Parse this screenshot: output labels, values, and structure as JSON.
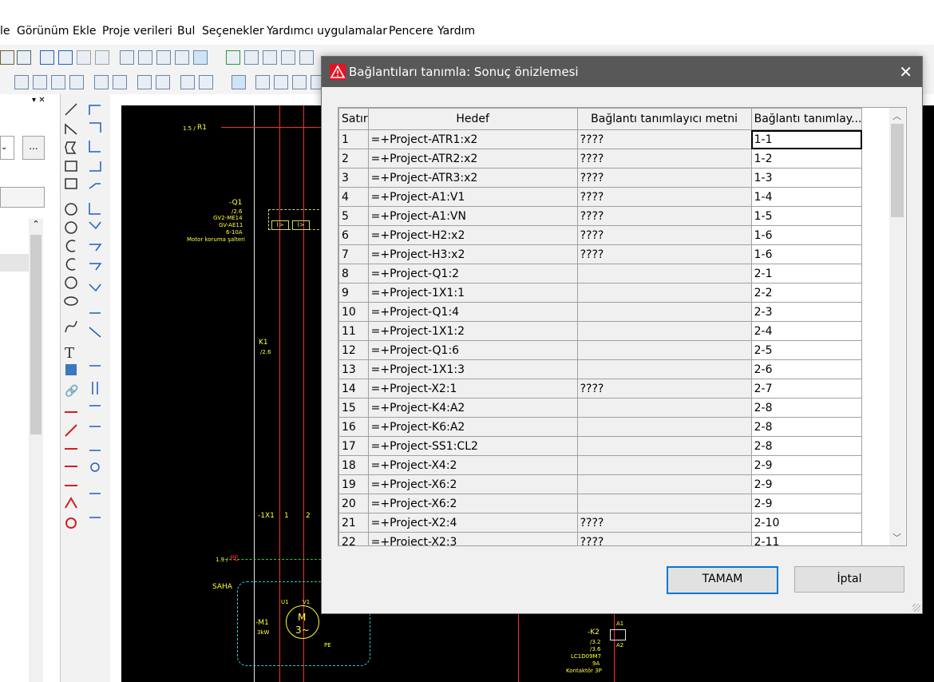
{
  "menu": [
    "le",
    "Görünüm",
    "Ekle",
    "Proje verileri",
    "Bul",
    "Seçenekler",
    "Yardımcı uygulamalar",
    "Pencere",
    "Yardım"
  ],
  "left_panel": {
    "browse_button": "..."
  },
  "canvas": {
    "labels": {
      "r1": "R1",
      "r1_ref": "1.5 /",
      "q1": "-Q1",
      "q1_ref": "/2.6",
      "q1_t1": "GV2-ME14",
      "q1_t2": "GV-AE11",
      "q1_t3": "6-10A",
      "q1_desc": "Motor koruma şalteri",
      "k1": "K1",
      "k1_ref": "/2.6",
      "x1": "-1X1",
      "x1_1": "1",
      "x1_2": "2",
      "pe": "PE",
      "pe_ref": "1.9 /",
      "saha": "SAHA",
      "m1": "-M1",
      "m1_kw": "3kW",
      "motor_m": "M",
      "motor_ph": "3~",
      "motor_pe": "PE",
      "u1": "U1",
      "v1": "V1",
      "k2": "-K2",
      "k2_r1": "/3.2",
      "k2_r2": "/3.6",
      "k2_type": "LC1D09M7",
      "k2_a": "9A",
      "k2_desc": "Kontaktör 3P",
      "a1": "A1",
      "a2": "A2",
      "ib1": "I>",
      "ib2": "I>"
    }
  },
  "dialog": {
    "title": "Bağlantıları tanımla: Sonuç önizlemesi",
    "columns": [
      "Satır",
      "Hedef",
      "Bağlantı tanımlayıcı metni",
      "Bağlantı tanımlay..."
    ],
    "rows": [
      {
        "n": "1",
        "target": "=+Project-ATR1:x2",
        "text": "????",
        "id": "1-1"
      },
      {
        "n": "2",
        "target": "=+Project-ATR2:x2",
        "text": "????",
        "id": "1-2"
      },
      {
        "n": "3",
        "target": "=+Project-ATR3:x2",
        "text": "????",
        "id": "1-3"
      },
      {
        "n": "4",
        "target": "=+Project-A1:V1",
        "text": "????",
        "id": "1-4"
      },
      {
        "n": "5",
        "target": "=+Project-A1:VN",
        "text": "????",
        "id": "1-5"
      },
      {
        "n": "6",
        "target": "=+Project-H2:x2",
        "text": "????",
        "id": "1-6"
      },
      {
        "n": "7",
        "target": "=+Project-H3:x2",
        "text": "????",
        "id": "1-6"
      },
      {
        "n": "8",
        "target": "=+Project-Q1:2",
        "text": "",
        "id": "2-1"
      },
      {
        "n": "9",
        "target": "=+Project-1X1:1",
        "text": "",
        "id": "2-2"
      },
      {
        "n": "10",
        "target": "=+Project-Q1:4",
        "text": "",
        "id": "2-3"
      },
      {
        "n": "11",
        "target": "=+Project-1X1:2",
        "text": "",
        "id": "2-4"
      },
      {
        "n": "12",
        "target": "=+Project-Q1:6",
        "text": "",
        "id": "2-5"
      },
      {
        "n": "13",
        "target": "=+Project-1X1:3",
        "text": "",
        "id": "2-6"
      },
      {
        "n": "14",
        "target": "=+Project-X2:1",
        "text": "????",
        "id": "2-7"
      },
      {
        "n": "15",
        "target": "=+Project-K4:A2",
        "text": "",
        "id": "2-8"
      },
      {
        "n": "16",
        "target": "=+Project-K6:A2",
        "text": "",
        "id": "2-8"
      },
      {
        "n": "17",
        "target": "=+Project-SS1:CL2",
        "text": "",
        "id": "2-8"
      },
      {
        "n": "18",
        "target": "=+Project-X4:2",
        "text": "",
        "id": "2-9"
      },
      {
        "n": "19",
        "target": "=+Project-X6:2",
        "text": "",
        "id": "2-9"
      },
      {
        "n": "20",
        "target": "=+Project-X6:2",
        "text": "",
        "id": "2-9"
      },
      {
        "n": "21",
        "target": "=+Project-X2:4",
        "text": "????",
        "id": "2-10"
      },
      {
        "n": "22",
        "target": "=+Project-X2:3",
        "text": "????",
        "id": "2-11"
      }
    ],
    "ok_label": "TAMAM",
    "cancel_label": "İptal",
    "close_symbol": "✕"
  },
  "colors": {
    "titlebar": "#585858",
    "warning": "#e81123",
    "cad_background": "#000000",
    "cad_text": "#ffff3c",
    "cad_wire_red": "#ff2a2a",
    "primary_button_border": "#0078d7"
  }
}
